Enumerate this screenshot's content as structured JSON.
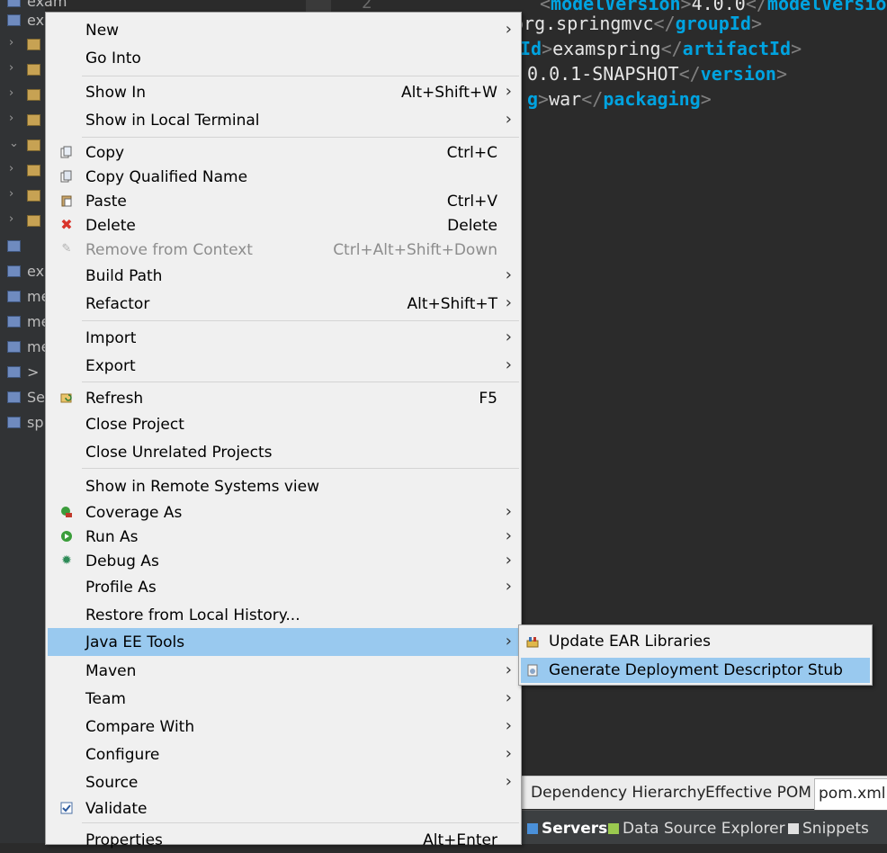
{
  "tree": {
    "items": [
      {
        "label": "exam",
        "chevron": ""
      },
      {
        "label": "ex",
        "chevron": ""
      },
      {
        "label": "",
        "chevron": "›"
      },
      {
        "label": "",
        "chevron": "›"
      },
      {
        "label": "",
        "chevron": "›"
      },
      {
        "label": "",
        "chevron": "›"
      },
      {
        "label": "",
        "chevron": "⌄"
      },
      {
        "label": "",
        "chevron": "›"
      },
      {
        "label": "",
        "chevron": "›"
      },
      {
        "label": "",
        "chevron": "›"
      },
      {
        "label": "",
        "chevron": ""
      },
      {
        "label": "ex",
        "chevron": ""
      },
      {
        "label": "me",
        "chevron": ""
      },
      {
        "label": "me",
        "chevron": ""
      },
      {
        "label": "me",
        "chevron": ""
      },
      {
        "label": ">",
        "chevron": ""
      },
      {
        "label": "Se",
        "chevron": ""
      },
      {
        "label": "sp",
        "chevron": ""
      }
    ]
  },
  "editor": {
    "line_number": "2",
    "lines": [
      {
        "open": "modelVersion",
        "value": "4.0.0",
        "close": "modelVersion"
      },
      {
        "open": "",
        "value": "org.springmvc",
        "close": "groupId"
      },
      {
        "open": "Id",
        "value": "examspring",
        "close": "artifactId"
      },
      {
        "open": "",
        "value": "0.0.1-SNAPSHOT",
        "close": "version"
      },
      {
        "open": "g",
        "value": "war",
        "close": "packaging"
      }
    ]
  },
  "pom_tabs": [
    "Dependency Hierarchy",
    "Effective POM",
    "pom.xml"
  ],
  "bottom_views": [
    "Servers",
    "Data Source Explorer",
    "Snippets"
  ],
  "menu": {
    "new": {
      "label": "New"
    },
    "go_into": {
      "label": "Go Into"
    },
    "show_in": {
      "label": "Show In",
      "shortcut": "Alt+Shift+W"
    },
    "show_local_terminal": {
      "label": "Show in Local Terminal"
    },
    "copy": {
      "label": "Copy",
      "shortcut": "Ctrl+C"
    },
    "copy_qualified": {
      "label": "Copy Qualified Name"
    },
    "paste": {
      "label": "Paste",
      "shortcut": "Ctrl+V"
    },
    "delete": {
      "label": "Delete",
      "shortcut": "Delete"
    },
    "remove_context": {
      "label": "Remove from Context",
      "shortcut": "Ctrl+Alt+Shift+Down"
    },
    "build_path": {
      "label": "Build Path"
    },
    "refactor": {
      "label": "Refactor",
      "shortcut": "Alt+Shift+T"
    },
    "import": {
      "label": "Import"
    },
    "export": {
      "label": "Export"
    },
    "refresh": {
      "label": "Refresh",
      "shortcut": "F5"
    },
    "close_project": {
      "label": "Close Project"
    },
    "close_unrelated": {
      "label": "Close Unrelated Projects"
    },
    "show_remote": {
      "label": "Show in Remote Systems view"
    },
    "coverage_as": {
      "label": "Coverage As"
    },
    "run_as": {
      "label": "Run As"
    },
    "debug_as": {
      "label": "Debug As"
    },
    "profile_as": {
      "label": "Profile As"
    },
    "restore_history": {
      "label": "Restore from Local History..."
    },
    "java_ee_tools": {
      "label": "Java EE Tools"
    },
    "maven": {
      "label": "Maven"
    },
    "team": {
      "label": "Team"
    },
    "compare_with": {
      "label": "Compare With"
    },
    "configure": {
      "label": "Configure"
    },
    "source": {
      "label": "Source"
    },
    "validate": {
      "label": "Validate"
    },
    "properties": {
      "label": "Properties",
      "shortcut": "Alt+Enter"
    }
  },
  "submenu": {
    "update_ear": {
      "label": "Update EAR Libraries"
    },
    "generate_dd": {
      "label": "Generate Deployment Descriptor Stub"
    }
  }
}
